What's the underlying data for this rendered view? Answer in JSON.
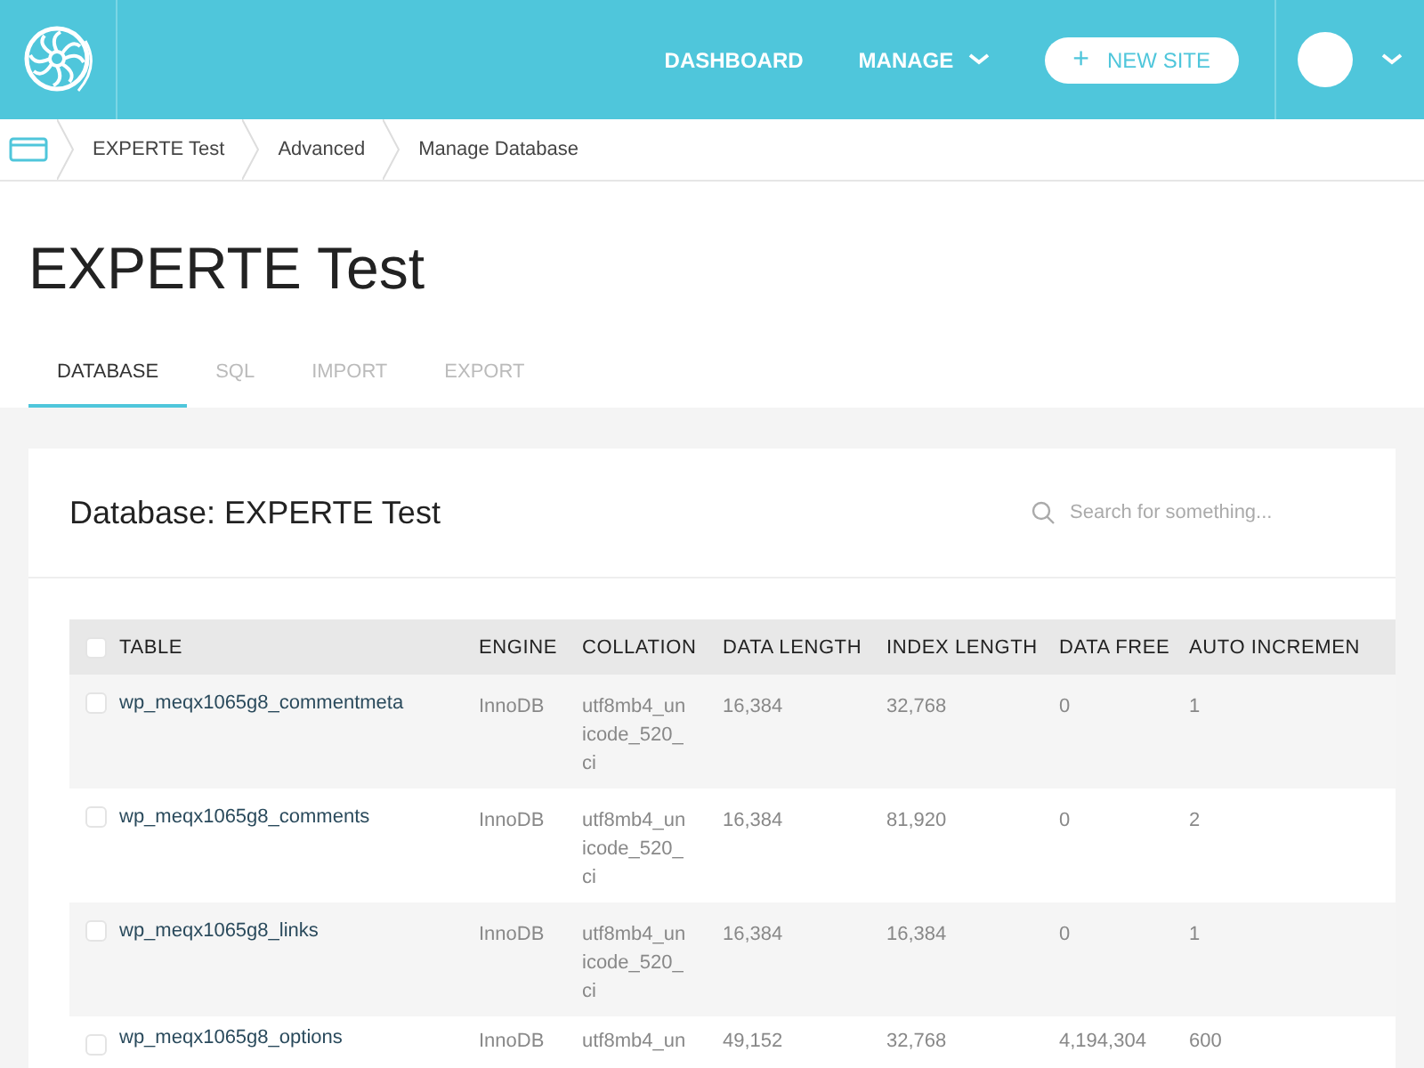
{
  "header": {
    "nav": [
      {
        "label": "DASHBOARD",
        "kind": "link"
      },
      {
        "label": "MANAGE",
        "kind": "menu"
      }
    ],
    "new_site_button": {
      "icon": "+",
      "label": "NEW SITE"
    }
  },
  "breadcrumbs": [
    "EXPERTE Test",
    "Advanced",
    "Manage Database"
  ],
  "title": "EXPERTE Test",
  "tabs": [
    {
      "label": "DATABASE",
      "selected": true
    },
    {
      "label": "SQL",
      "selected": false
    },
    {
      "label": "IMPORT",
      "selected": false
    },
    {
      "label": "EXPORT",
      "selected": false
    }
  ],
  "card": {
    "title": "Database: EXPERTE Test",
    "search": {
      "placeholder": "Search for something..."
    }
  },
  "table": {
    "columns": [
      "TABLE",
      "ENGINE",
      "COLLATION",
      "DATA LENGTH",
      "INDEX LENGTH",
      "DATA FREE",
      "AUTO INCREMEN"
    ],
    "all_checked": false,
    "rows": [
      {
        "checked": false,
        "cells": [
          "wp_meqx1065g8_commentmeta",
          "InnoDB",
          "utf8mb4_unicode_520_ci",
          "16,384",
          "32,768",
          "0",
          "1"
        ]
      },
      {
        "checked": false,
        "cells": [
          "wp_meqx1065g8_comments",
          "InnoDB",
          "utf8mb4_unicode_520_ci",
          "16,384",
          "81,920",
          "0",
          "2"
        ]
      },
      {
        "checked": false,
        "cells": [
          "wp_meqx1065g8_links",
          "InnoDB",
          "utf8mb4_unicode_520_ci",
          "16,384",
          "16,384",
          "0",
          "1"
        ]
      },
      {
        "checked": false,
        "cells": [
          "wp_meqx1065g8_options",
          "InnoDB",
          "utf8mb4_un",
          "49,152",
          "32,768",
          "4,194,304",
          "600"
        ]
      }
    ]
  }
}
